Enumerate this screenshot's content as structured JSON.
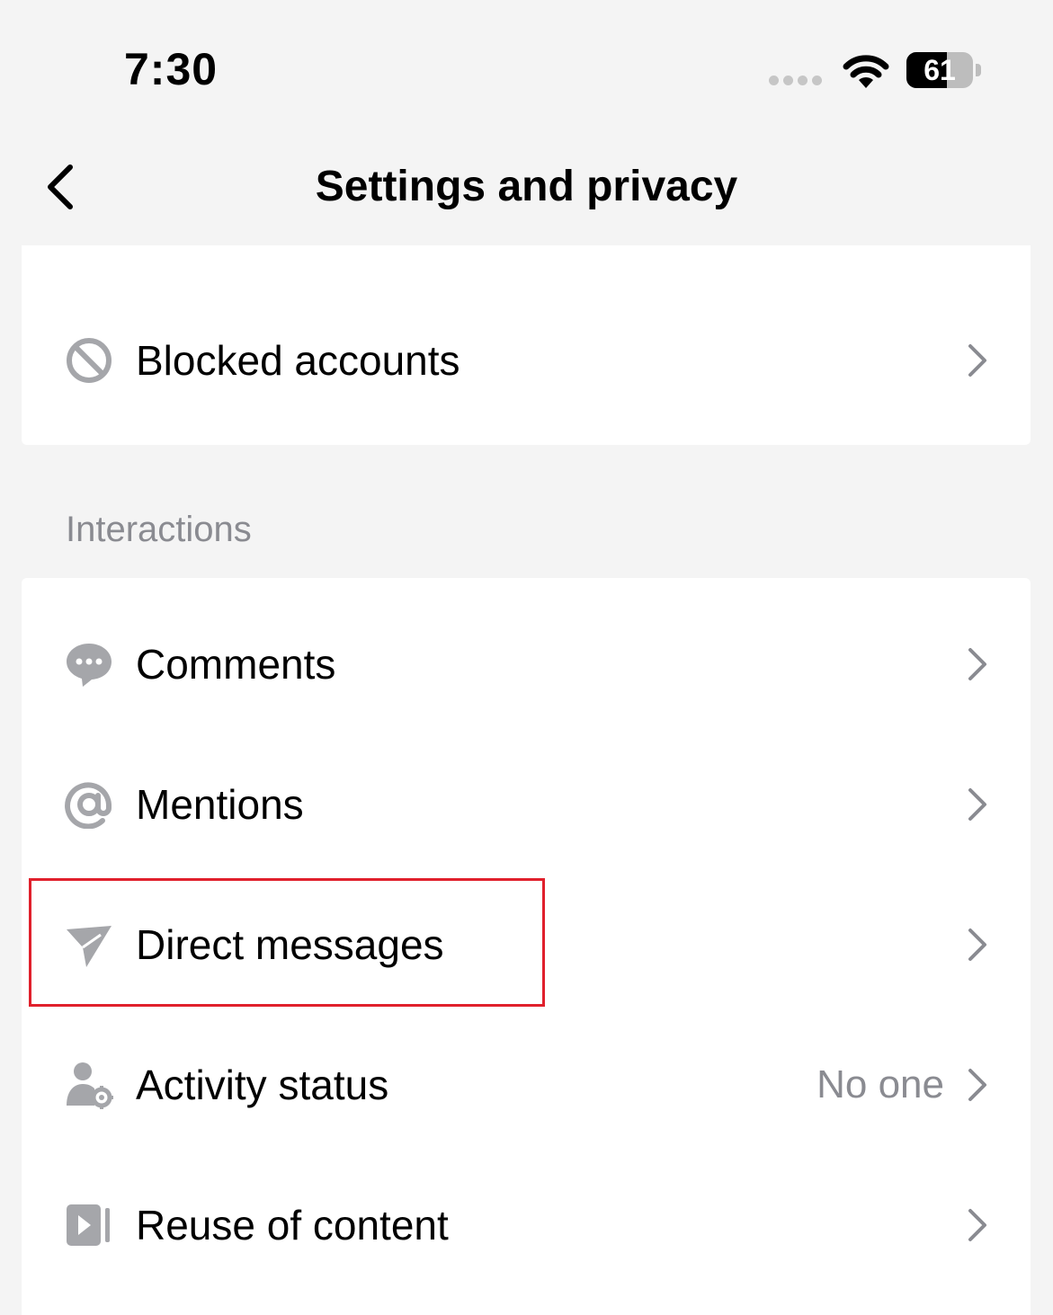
{
  "status_bar": {
    "time": "7:30",
    "battery_level": "61",
    "battery_fraction": 0.61
  },
  "header": {
    "title": "Settings and privacy",
    "back_icon": "chevron-left-icon"
  },
  "top_card": {
    "items": [
      {
        "label": "Blocked accounts",
        "icon": "blocked-icon"
      }
    ]
  },
  "interactions": {
    "section_label": "Interactions",
    "items": [
      {
        "label": "Comments",
        "icon": "comment-bubble-icon",
        "value": ""
      },
      {
        "label": "Mentions",
        "icon": "at-sign-icon",
        "value": ""
      },
      {
        "label": "Direct messages",
        "icon": "paper-plane-icon",
        "value": ""
      },
      {
        "label": "Activity status",
        "icon": "user-gear-icon",
        "value": "No one"
      },
      {
        "label": "Reuse of content",
        "icon": "video-play-icon",
        "value": ""
      }
    ]
  },
  "colors": {
    "background": "#f4f4f4",
    "card": "#ffffff",
    "icon_gray": "#a5a6aa",
    "secondary_text": "#8a8b91",
    "highlight": "#e0202c"
  }
}
